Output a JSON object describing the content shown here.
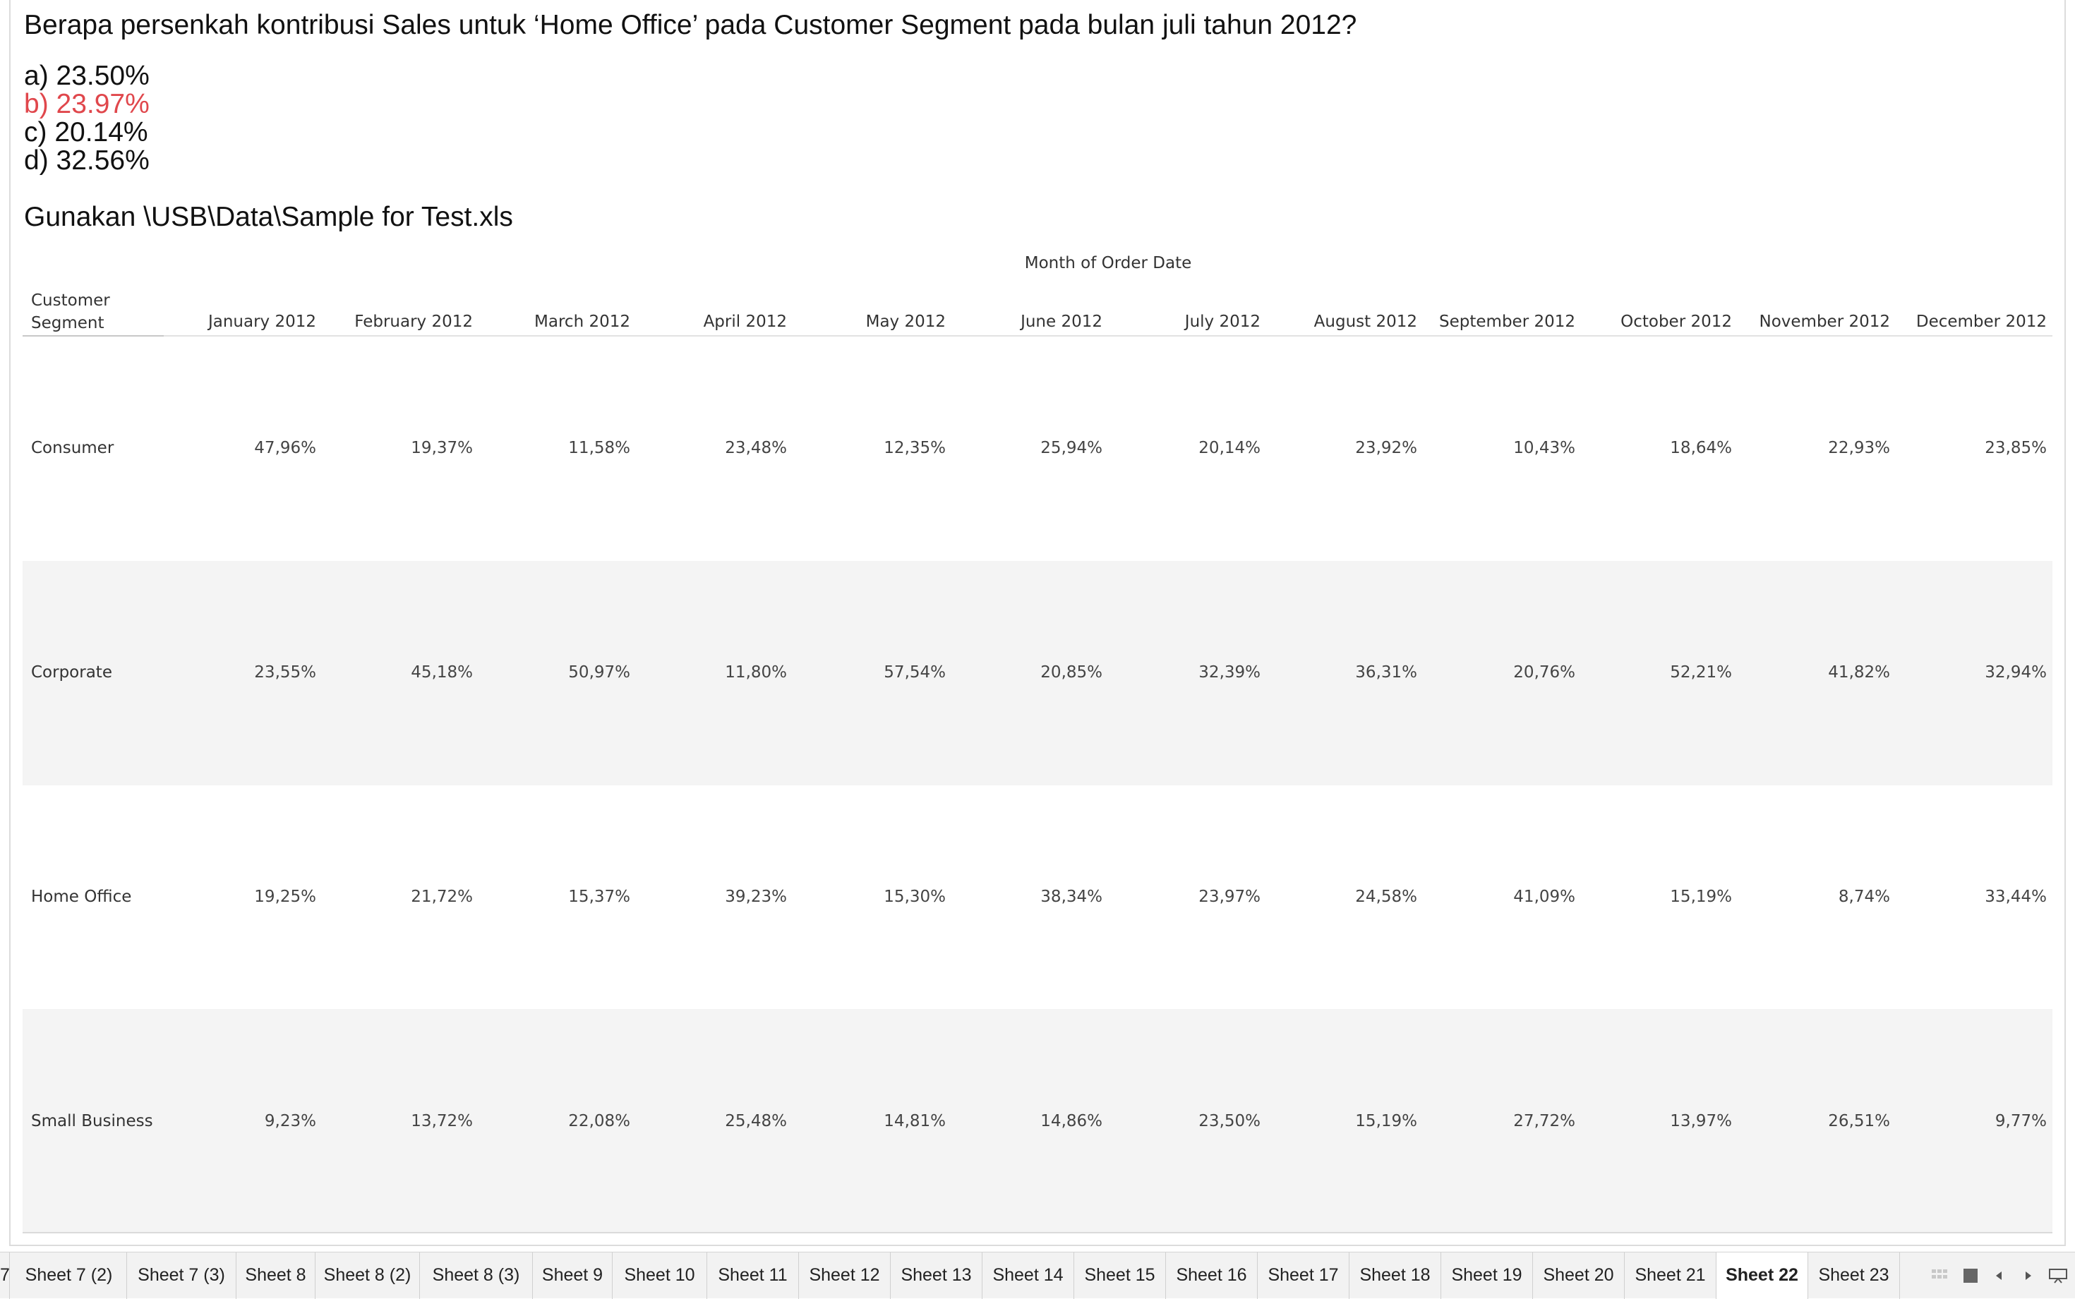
{
  "question": "Berapa persenkah kontribusi Sales untuk ‘Home Office’ pada Customer Segment pada bulan juli tahun 2012?",
  "options": [
    {
      "text": "a) 23.50%",
      "correct": false
    },
    {
      "text": "b) 23.97%",
      "correct": true
    },
    {
      "text": "c) 20.14%",
      "correct": false
    },
    {
      "text": "d) 32.56%",
      "correct": false
    }
  ],
  "instruction": "Gunakan \\USB\\Data\\Sample for Test.xls",
  "table": {
    "column_group_title": "Month of Order Date",
    "row_header_line1": "Customer",
    "row_header_line2": "Segment",
    "months": [
      "January 2012",
      "February 2012",
      "March 2012",
      "April 2012",
      "May 2012",
      "June 2012",
      "July 2012",
      "August 2012",
      "September 2012",
      "October 2012",
      "November 2012",
      "December 2012"
    ],
    "rows": [
      {
        "segment": "Consumer",
        "values": [
          "47,96%",
          "19,37%",
          "11,58%",
          "23,48%",
          "12,35%",
          "25,94%",
          "20,14%",
          "23,92%",
          "10,43%",
          "18,64%",
          "22,93%",
          "23,85%"
        ]
      },
      {
        "segment": "Corporate",
        "values": [
          "23,55%",
          "45,18%",
          "50,97%",
          "11,80%",
          "57,54%",
          "20,85%",
          "32,39%",
          "36,31%",
          "20,76%",
          "52,21%",
          "41,82%",
          "32,94%"
        ]
      },
      {
        "segment": "Home Office",
        "values": [
          "19,25%",
          "21,72%",
          "15,37%",
          "39,23%",
          "15,30%",
          "38,34%",
          "23,97%",
          "24,58%",
          "41,09%",
          "15,19%",
          "8,74%",
          "33,44%"
        ]
      },
      {
        "segment": "Small Business",
        "values": [
          "9,23%",
          "13,72%",
          "22,08%",
          "25,48%",
          "14,81%",
          "14,86%",
          "23,50%",
          "15,19%",
          "27,72%",
          "13,97%",
          "26,51%",
          "9,77%"
        ]
      }
    ]
  },
  "tabs": {
    "partial_left": "7",
    "items": [
      "Sheet 7 (2)",
      "Sheet 7 (3)",
      "Sheet 8",
      "Sheet 8 (2)",
      "Sheet 8 (3)",
      "Sheet 9",
      "Sheet 10",
      "Sheet 11",
      "Sheet 12",
      "Sheet 13",
      "Sheet 14",
      "Sheet 15",
      "Sheet 16",
      "Sheet 17",
      "Sheet 18",
      "Sheet 19",
      "Sheet 20",
      "Sheet 21",
      "Sheet 22",
      "Sheet 23"
    ],
    "active": "Sheet 22"
  },
  "tab_controls": [
    "filmstrip-view-icon",
    "tab-view-icon",
    "scroll-left-icon",
    "scroll-right-icon",
    "presentation-mode-icon"
  ],
  "colors": {
    "correct_answer": "#e0474c",
    "band_alt": "#f4f4f4"
  }
}
